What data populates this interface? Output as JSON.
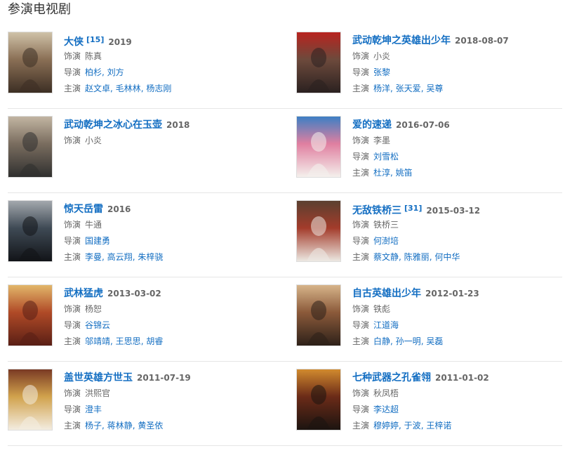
{
  "section": {
    "title": "参演电视剧"
  },
  "labels": {
    "role": "饰演",
    "director": "导演",
    "cast": "主演"
  },
  "rows": [
    {
      "left": {
        "title": "大侠",
        "cite": "[15]",
        "date": "2019",
        "role": "陈真",
        "directors": [
          "柏杉",
          "刘方"
        ],
        "cast": [
          "赵文卓",
          "毛林林",
          "杨志刚"
        ],
        "poster_colors": [
          "#3d2f24",
          "#8a6f55",
          "#cfc2a8"
        ]
      },
      "right": {
        "title": "武动乾坤之英雄出少年",
        "cite": "",
        "date": "2018-08-07",
        "role": "小炎",
        "directors": [
          "张黎"
        ],
        "cast": [
          "杨洋",
          "张天爱",
          "吴尊"
        ],
        "poster_colors": [
          "#2b2120",
          "#6d4a3c",
          "#b8231f"
        ]
      }
    },
    {
      "left": {
        "title": "武动乾坤之冰心在玉壶",
        "cite": "",
        "date": "2018",
        "role": "小炎",
        "directors": [],
        "cast": [],
        "poster_colors": [
          "#30302f",
          "#7a6d5f",
          "#c2b5a2"
        ]
      },
      "right": {
        "title": "爱的速递",
        "cite": "",
        "date": "2016-07-06",
        "role": "李墨",
        "directors": [
          "刘雪松"
        ],
        "cast": [
          "杜淳",
          "姚笛"
        ],
        "poster_colors": [
          "#f4f0ec",
          "#e07fa0",
          "#3d7fc4"
        ]
      }
    },
    {
      "left": {
        "title": "惊天岳雷",
        "cite": "",
        "date": "2016",
        "role": "牛通",
        "directors": [
          "国建勇"
        ],
        "cast": [
          "李曼",
          "高云翔",
          "朱梓骁"
        ],
        "poster_colors": [
          "#121418",
          "#3f4a55",
          "#a3a8ad"
        ]
      },
      "right": {
        "title": "无敌铁桥三",
        "cite": "[31]",
        "date": "2015-03-12",
        "role": "铁桥三",
        "directors": [
          "何澍培"
        ],
        "cast": [
          "蔡文静",
          "陈雅丽",
          "何中华"
        ],
        "poster_colors": [
          "#ece8e2",
          "#a33c2b",
          "#5b4030"
        ]
      }
    },
    {
      "left": {
        "title": "武林猛虎",
        "cite": "",
        "date": "2013-03-02",
        "role": "杨恕",
        "directors": [
          "谷锦云"
        ],
        "cast": [
          "邬靖靖",
          "王思思",
          "胡睿"
        ],
        "poster_colors": [
          "#5a1f15",
          "#b04a27",
          "#e2b66a"
        ]
      },
      "right": {
        "title": "自古英雄出少年",
        "cite": "",
        "date": "2012-01-23",
        "role": "铁彪",
        "directors": [
          "江道海"
        ],
        "cast": [
          "白静",
          "孙一明",
          "吴磊"
        ],
        "poster_colors": [
          "#2e2119",
          "#8b5a3a",
          "#d7b48a"
        ]
      }
    },
    {
      "left": {
        "title": "盖世英雄方世玉",
        "cite": "",
        "date": "2011-07-19",
        "role": "洪熙官",
        "directors": [
          "澄丰"
        ],
        "cast": [
          "杨子",
          "蒋林静",
          "黄圣依"
        ],
        "poster_colors": [
          "#f3ece0",
          "#d1a24c",
          "#7a3a24"
        ]
      },
      "right": {
        "title": "七种武器之孔雀翎",
        "cite": "",
        "date": "2011-01-02",
        "role": "秋凤梧",
        "directors": [
          "李达超"
        ],
        "cast": [
          "穆婷婷",
          "于波",
          "王梓诺"
        ],
        "poster_colors": [
          "#1c1410",
          "#6b2b18",
          "#d18a2e"
        ]
      }
    }
  ]
}
